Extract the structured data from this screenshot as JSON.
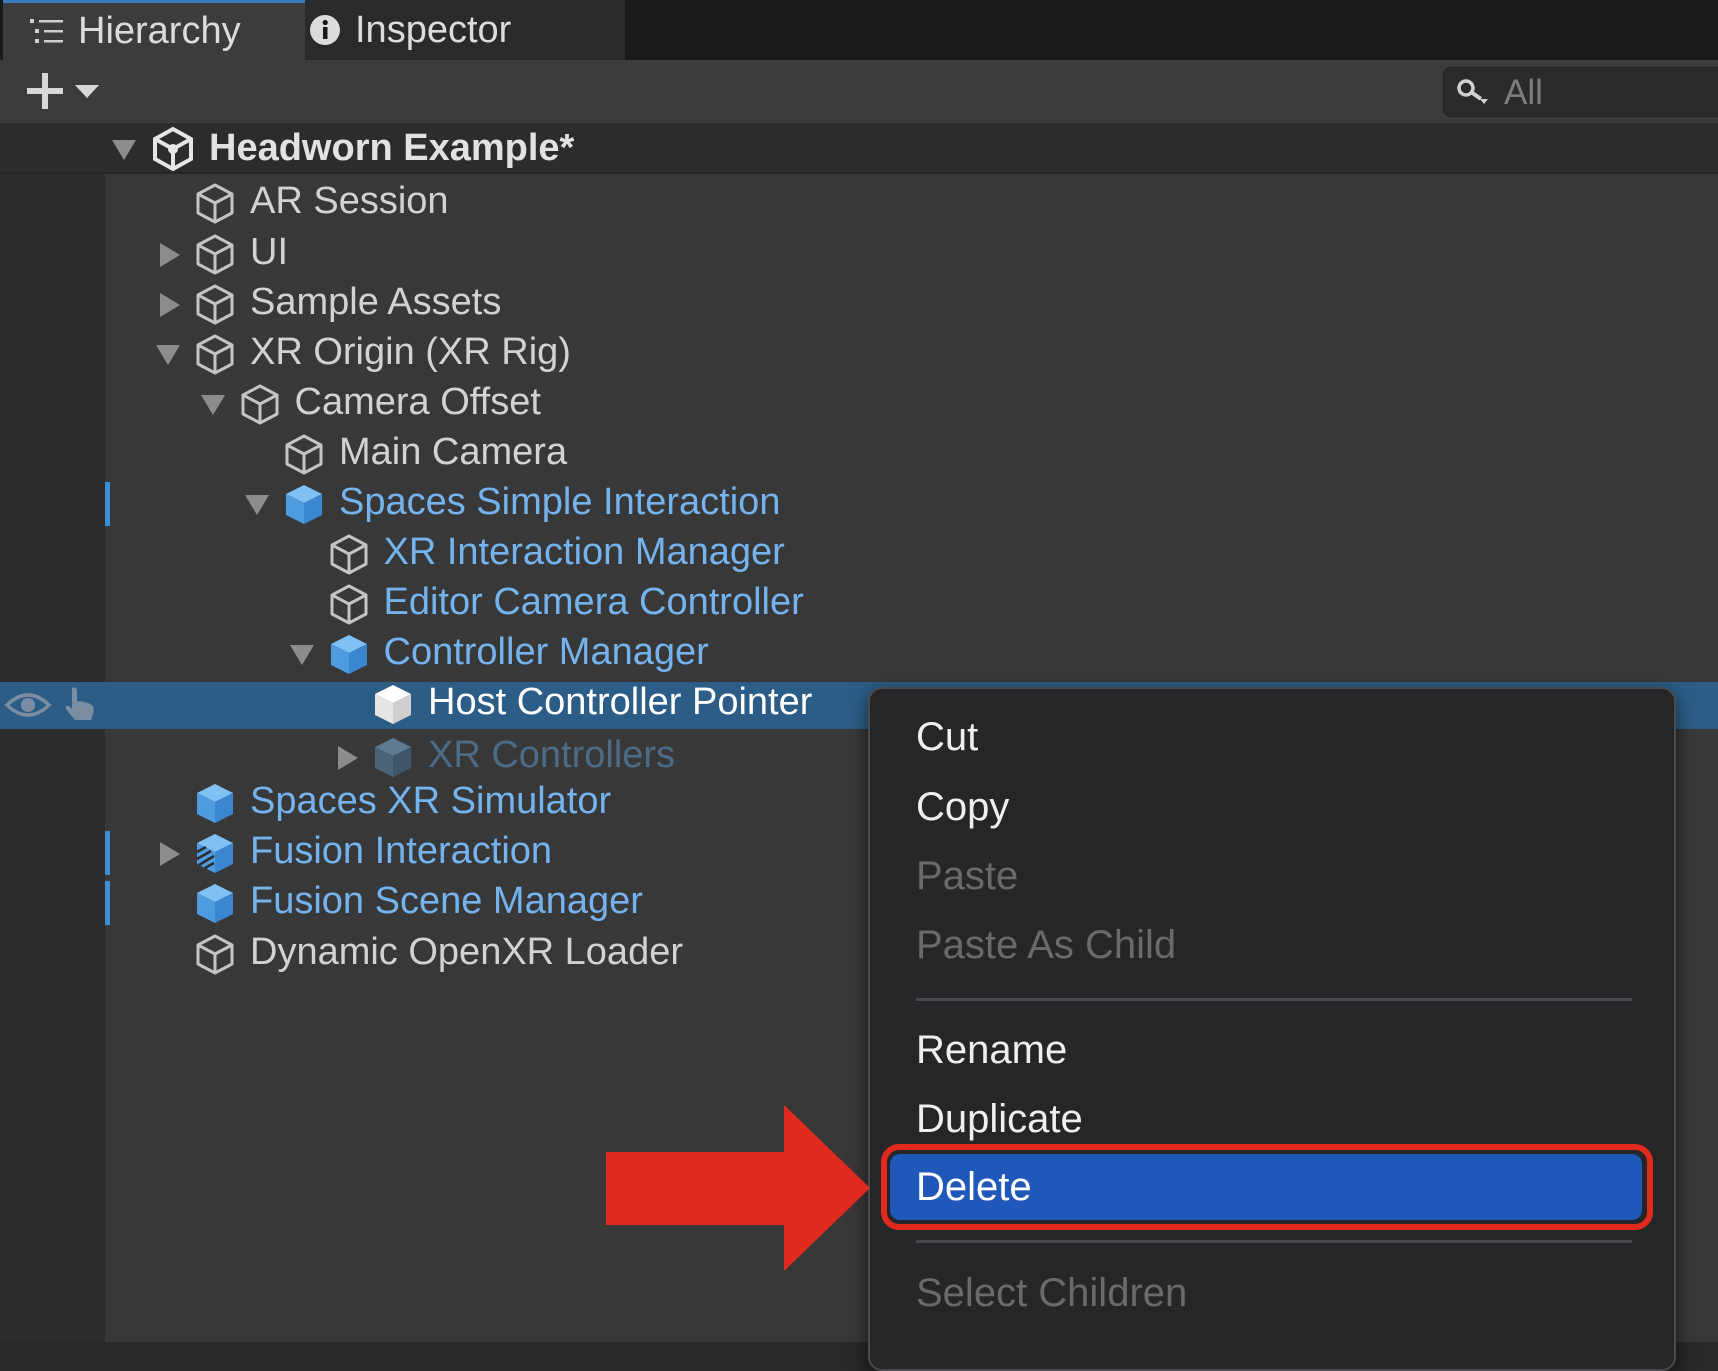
{
  "tabs": [
    {
      "label": "Hierarchy",
      "icon": "list-icon",
      "active": true
    },
    {
      "label": "Inspector",
      "icon": "info-icon",
      "active": false
    }
  ],
  "toolbar": {
    "add_icon": "plus-icon",
    "dropdown_icon": "caret-down-icon"
  },
  "search": {
    "placeholder": "All",
    "icon": "search-icon"
  },
  "scene": {
    "name": "Headworn Example*",
    "icon": "unity-scene-icon"
  },
  "tree": [
    {
      "label": "AR Session",
      "depth": 0,
      "expander": "none",
      "icon": "gameobject-icon",
      "style": "white"
    },
    {
      "label": "UI",
      "depth": 0,
      "expander": "collapsed",
      "icon": "gameobject-icon",
      "style": "white"
    },
    {
      "label": "Sample Assets",
      "depth": 0,
      "expander": "collapsed",
      "icon": "gameobject-icon",
      "style": "white"
    },
    {
      "label": "XR Origin (XR Rig)",
      "depth": 0,
      "expander": "expanded",
      "icon": "gameobject-icon",
      "style": "white"
    },
    {
      "label": "Camera Offset",
      "depth": 1,
      "expander": "expanded",
      "icon": "gameobject-icon",
      "style": "white"
    },
    {
      "label": "Main Camera",
      "depth": 2,
      "expander": "none",
      "icon": "gameobject-icon",
      "style": "white"
    },
    {
      "label": "Spaces Simple Interaction",
      "depth": 2,
      "expander": "expanded",
      "icon": "prefab-icon",
      "style": "blue",
      "modified": true
    },
    {
      "label": "XR Interaction Manager",
      "depth": 3,
      "expander": "none",
      "icon": "gameobject-icon",
      "style": "blue"
    },
    {
      "label": "Editor Camera Controller",
      "depth": 3,
      "expander": "none",
      "icon": "gameobject-icon",
      "style": "blue"
    },
    {
      "label": "Controller Manager",
      "depth": 3,
      "expander": "expanded",
      "icon": "prefab-icon",
      "style": "blue"
    },
    {
      "label": "Host Controller Pointer",
      "depth": 4,
      "expander": "none",
      "icon": "prefab-icon-white",
      "style": "selected",
      "selected": true
    },
    {
      "label": "XR Controllers",
      "depth": 4,
      "expander": "collapsed",
      "icon": "prefab-icon-dim",
      "style": "dimblue"
    },
    {
      "label": "Spaces XR Simulator",
      "depth": 0,
      "expander": "none",
      "icon": "prefab-icon",
      "style": "blue"
    },
    {
      "label": "Fusion Interaction",
      "depth": 0,
      "expander": "collapsed",
      "icon": "prefab-variant-icon",
      "style": "blue",
      "modified": true
    },
    {
      "label": "Fusion Scene Manager",
      "depth": 0,
      "expander": "none",
      "icon": "prefab-icon",
      "style": "blue",
      "modified": true
    },
    {
      "label": "Dynamic OpenXR Loader",
      "depth": 0,
      "expander": "none",
      "icon": "gameobject-icon",
      "style": "white"
    }
  ],
  "row_toggles": {
    "visibility_icon": "eye-icon",
    "pickable_icon": "hand-pointer-icon"
  },
  "context_menu": {
    "items": [
      {
        "label": "Cut",
        "enabled": true
      },
      {
        "label": "Copy",
        "enabled": true
      },
      {
        "label": "Paste",
        "enabled": false
      },
      {
        "label": "Paste As Child",
        "enabled": false
      },
      {
        "separator": true
      },
      {
        "label": "Rename",
        "enabled": true
      },
      {
        "label": "Duplicate",
        "enabled": true
      },
      {
        "label": "Delete",
        "enabled": true,
        "highlighted": true
      },
      {
        "separator": true
      },
      {
        "label": "Select Children",
        "enabled": false
      }
    ]
  },
  "colors": {
    "accent": "#3a79bb",
    "prefab_blue": "#74b3ee",
    "selection": "#2c5d87",
    "menu_highlight": "#1f58b8",
    "annotation_red": "#e02a1e"
  }
}
